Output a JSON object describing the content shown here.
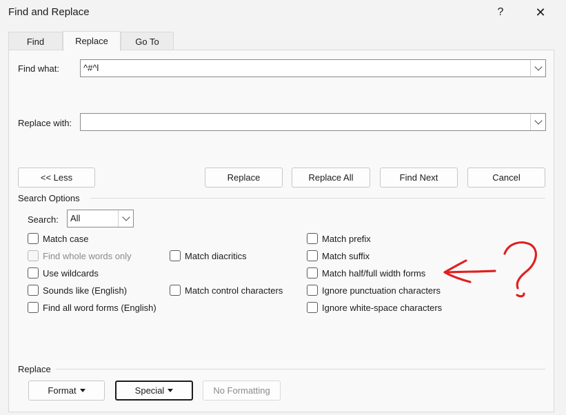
{
  "window": {
    "title": "Find and Replace",
    "help_label": "?",
    "close_label": "✕"
  },
  "tabs": [
    {
      "label": "Find"
    },
    {
      "label": "Replace"
    },
    {
      "label": "Go To"
    }
  ],
  "find_what": {
    "label": "Find what:",
    "value": "^#^l"
  },
  "replace_with": {
    "label": "Replace with:",
    "value": ""
  },
  "buttons": {
    "less": "<< Less",
    "replace": "Replace",
    "replace_all": "Replace All",
    "find_next": "Find Next",
    "cancel": "Cancel"
  },
  "search_options": {
    "title": "Search Options",
    "search_label": "Search:",
    "search_value": "All",
    "checkboxes_left": [
      {
        "label": "Match case",
        "checked": false,
        "disabled": false
      },
      {
        "label": "Find whole words only",
        "checked": false,
        "disabled": true
      },
      {
        "label": "Use wildcards",
        "checked": false,
        "disabled": false
      },
      {
        "label": "Sounds like (English)",
        "checked": false,
        "disabled": false
      },
      {
        "label": "Find all word forms (English)",
        "checked": false,
        "disabled": false
      }
    ],
    "checkboxes_mid": [
      {
        "label": "Match diacritics",
        "checked": false
      },
      {
        "label": "Match control characters",
        "checked": false
      }
    ],
    "checkboxes_right": [
      {
        "label": "Match prefix",
        "checked": false
      },
      {
        "label": "Match suffix",
        "checked": false
      },
      {
        "label": "Match half/full width forms",
        "checked": false
      },
      {
        "label": "Ignore punctuation characters",
        "checked": false
      },
      {
        "label": "Ignore white-space characters",
        "checked": false
      }
    ]
  },
  "replace_section": {
    "title": "Replace",
    "format": "Format",
    "special": "Special",
    "no_formatting": "No Formatting"
  },
  "annotation": {
    "question_mark": "?",
    "color": "#e02020"
  }
}
